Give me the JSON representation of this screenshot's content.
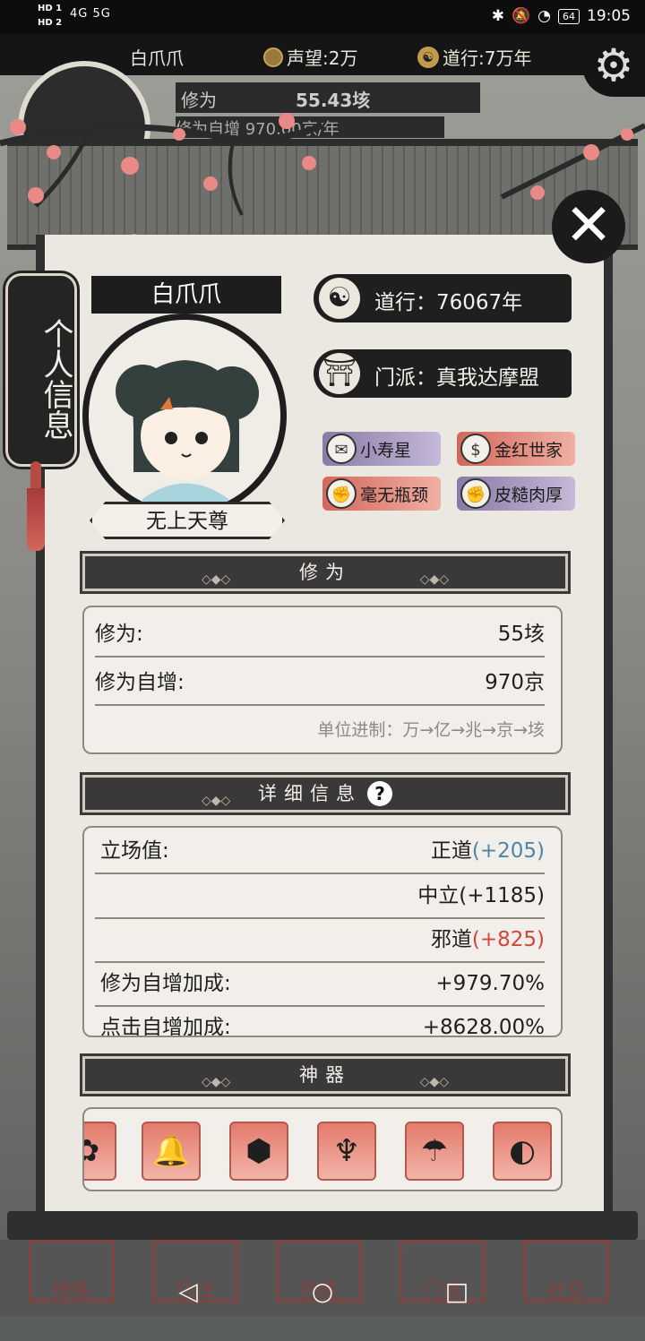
{
  "status_bar": {
    "hd1": "HD 1",
    "hd2": "HD 2",
    "network": "4G  5G",
    "battery": "64",
    "time": "19:05"
  },
  "top_bar": {
    "name": "白爪爪",
    "reputation": "声望:2万",
    "daoxing": "道行:7万年"
  },
  "background": {
    "cultivation_label": "修为",
    "cultivation_value": "55.43垓",
    "auto_increase_partial": "修为自增    970.00京/年"
  },
  "panel": {
    "tab_title": "个人信息",
    "player_name": "白爪爪",
    "title": "无上天尊",
    "daoxing": "道行：76067年",
    "sect": "门派：真我达摩盟",
    "traits": [
      {
        "label": "小寿星",
        "icon": "scroll-icon"
      },
      {
        "label": "金红世家",
        "icon": "money-bag-icon"
      },
      {
        "label": "毫无瓶颈",
        "icon": "fist-icon"
      },
      {
        "label": "皮糙肉厚",
        "icon": "fist-icon"
      }
    ]
  },
  "cultivation": {
    "header": "修为",
    "rows": [
      {
        "label": "修为:",
        "value": "55垓"
      },
      {
        "label": "修为自增:",
        "value": "970京"
      }
    ],
    "unit_note": "单位进制：万→亿→兆→京→垓"
  },
  "details": {
    "header": "详细信息",
    "help": "?",
    "stance_label": "立场值:",
    "righteous": "正道",
    "righteous_val": "(+205)",
    "neutral": "中立(+1185)",
    "evil": "邪道",
    "evil_val": "(+825)",
    "bonus_label": "修为自增加成:",
    "bonus_value": "+979.70%",
    "cut_row_label": "点击自增加成:",
    "cut_row_value": "+8628.00%"
  },
  "artifacts": {
    "header": "神器",
    "items": [
      "gold-ornament-icon",
      "bell-icon",
      "jade-seal-icon",
      "jade-pendant-icon",
      "umbrella-icon",
      "fan-icon"
    ]
  },
  "game_tabs": [
    "修炼",
    "功法",
    "历练",
    "门派",
    "社交"
  ],
  "nav": {
    "back": "◁",
    "home": "○",
    "recent": "□"
  },
  "colors": {
    "righteous": "#4f84a8",
    "evil": "#d1453b",
    "ink": "#1f1f1f"
  }
}
